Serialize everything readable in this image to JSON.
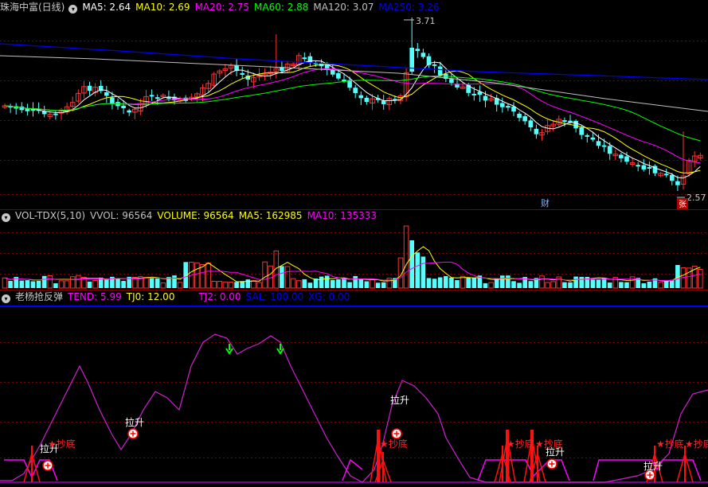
{
  "panel1": {
    "title": "珠海中富(日线)",
    "indicators": [
      {
        "label": "MA5: 2.64",
        "color": "#ffffff"
      },
      {
        "label": "MA10: 2.69",
        "color": "#ffff00"
      },
      {
        "label": "MA20: 2.75",
        "color": "#ff00ff"
      },
      {
        "label": "MA60: 2.88",
        "color": "#00ff00"
      },
      {
        "label": "MA120: 3.07",
        "color": "#c0c0c0"
      },
      {
        "label": "MA250: 3.26",
        "color": "#0000ff"
      }
    ],
    "high_label": "3.71",
    "low_label": "2.57",
    "marker_cai": "财",
    "marker_k": "张"
  },
  "panel2": {
    "title": "VOL-TDX(5,10)",
    "indicators": [
      {
        "label": "VVOL: 96564",
        "color": "#c0c0c0"
      },
      {
        "label": "VOLUME: 96564",
        "color": "#ffff00"
      },
      {
        "label": "MA5: 162985",
        "color": "#ffff00"
      },
      {
        "label": "MA10: 135333",
        "color": "#ff00ff"
      }
    ]
  },
  "panel3": {
    "title": "老杨抢反弹",
    "indicators": [
      {
        "label": "TEND: 5.99",
        "color": "#ff00ff"
      },
      {
        "label": "TJ0: 12.00",
        "color": "#ffff00"
      },
      {
        "label": "TJ2: 0.00",
        "color": "#ff00ff"
      },
      {
        "label": "SAL: 100.00",
        "color": "#0000ff"
      },
      {
        "label": "XG: 0.00",
        "color": "#0000ff"
      }
    ],
    "label_lasheng": "拉升",
    "label_chaodi": "★抄底"
  },
  "colors": {
    "up": "#ff3232",
    "down": "#54ffff",
    "grid": "#800000",
    "border": "#800000"
  },
  "chart_data": [
    {
      "type": "candlestick",
      "title": "珠海中富(日线)",
      "series": [
        {
          "name": "MA5",
          "value": 2.64
        },
        {
          "name": "MA10",
          "value": 2.69
        },
        {
          "name": "MA20",
          "value": 2.75
        },
        {
          "name": "MA60",
          "value": 2.88
        },
        {
          "name": "MA120",
          "value": 3.07
        },
        {
          "name": "MA250",
          "value": 3.26
        }
      ],
      "annotations": [
        {
          "text": "3.71",
          "value": 3.71
        },
        {
          "text": "2.57",
          "value": 2.57
        }
      ]
    },
    {
      "type": "bar",
      "title": "VOL-TDX(5,10)",
      "series": [
        {
          "name": "VVOL",
          "value": 96564
        },
        {
          "name": "VOLUME",
          "value": 96564
        },
        {
          "name": "MA5",
          "value": 162985
        },
        {
          "name": "MA10",
          "value": 135333
        }
      ]
    },
    {
      "type": "line",
      "title": "老杨抢反弹",
      "series": [
        {
          "name": "TEND",
          "value": 5.99
        },
        {
          "name": "TJ0",
          "value": 12.0
        },
        {
          "name": "TJ2",
          "value": 0.0
        },
        {
          "name": "SAL",
          "value": 100.0
        },
        {
          "name": "XG",
          "value": 0.0
        }
      ]
    }
  ]
}
